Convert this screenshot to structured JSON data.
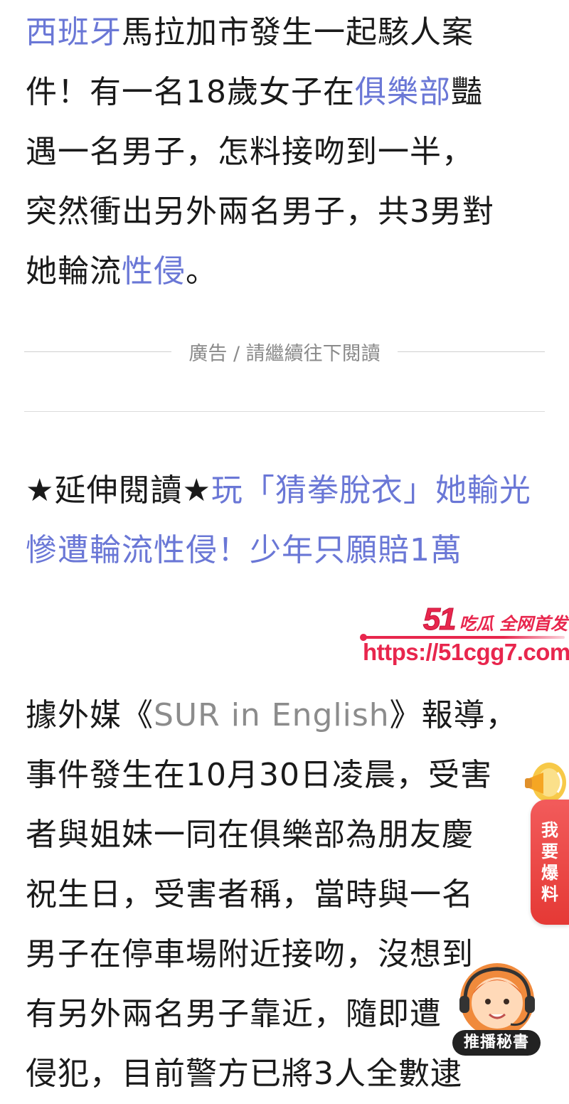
{
  "para1": {
    "l1_link": "西班牙",
    "l1_text": "馬拉加市發生一起駭人案",
    "l2_text": "件！有一名18歲女子在",
    "l2_link": "俱樂部",
    "l2_text2": "豔",
    "l3_text": "遇一名男子，怎料接吻到一半，",
    "l4_text": "突然衝出另外兩名男子，共3男對",
    "l5_text": "她輪流",
    "l5_link": "性侵",
    "l5_text2": "。"
  },
  "ad_divider": {
    "text": "廣告 / 請繼續往下閱讀"
  },
  "extended": {
    "tag": "★延伸閱讀★",
    "link_text": "玩「猜拳脫衣」她輸光慘遭輪流性侵！少年只願賠1萬"
  },
  "watermark": {
    "brand_num": "51",
    "brand_text": "吃瓜 全网首发",
    "url": "https://51cgg7.com"
  },
  "para3": {
    "l1_a": "據外媒《",
    "l1_en": "SUR in English",
    "l1_b": "》報導，",
    "l2": "事件發生在10月30日凌晨，受害",
    "l3": "者與姐妹一同在俱樂部為朋友慶",
    "l4": "祝生日，受害者稱，當時與一名",
    "l5": "男子在停車場附近接吻，沒想到",
    "l6": "有另外兩名男子靠近，隨即遭",
    "l7": "侵犯，目前警方已將3人全數逮"
  },
  "report_tab": {
    "chars": [
      "我",
      "要",
      "爆",
      "料"
    ]
  },
  "assistant": {
    "label": "推播秘書"
  },
  "colors": {
    "link": "#6a77d6",
    "watermark": "#e8264d",
    "report_tab": "#e53935"
  }
}
